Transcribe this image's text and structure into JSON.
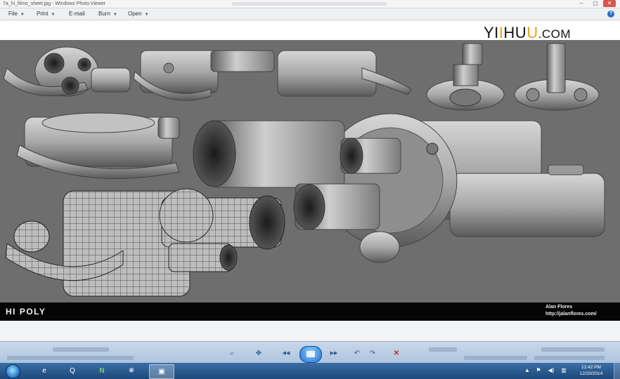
{
  "window": {
    "title": "7a_hi_filmo_sheet.jpg - Windows Photo Viewer",
    "minimize_glyph": "–",
    "maximize_glyph": "▢",
    "close_glyph": "✕"
  },
  "menu": {
    "items": [
      {
        "label": "File",
        "has_arrow": true
      },
      {
        "label": "Print",
        "has_arrow": true
      },
      {
        "label": "E-mail",
        "has_arrow": false
      },
      {
        "label": "Burn",
        "has_arrow": true
      },
      {
        "label": "Open",
        "has_arrow": true
      }
    ],
    "arrow_glyph": "▼",
    "help_glyph": "?"
  },
  "watermark": {
    "part1": "YI",
    "part2": "I",
    "part3": "HU",
    "part4": "U",
    "part5": ".COM"
  },
  "image": {
    "caption_left": "HI POLY",
    "author": "Alan Flores",
    "author_url": "http://jalanflores.com/"
  },
  "viewer_toolbar": {
    "zoom_glyph": "⌕",
    "actual_size_glyph": "✥",
    "previous_glyph": "◀◀",
    "next_glyph": "▶▶",
    "rotate_ccw_glyph": "↶",
    "rotate_cw_glyph": "↷",
    "delete_glyph": "✕"
  },
  "taskbar": {
    "apps": [
      {
        "name": "ie-app",
        "glyph": "e"
      },
      {
        "name": "quicktime-app",
        "glyph": "Q"
      },
      {
        "name": "n-app",
        "glyph": "N"
      },
      {
        "name": "network-app",
        "glyph": "❄"
      },
      {
        "name": "photo-viewer-app",
        "glyph": "▣"
      }
    ],
    "tray_expand_glyph": "▲",
    "flag_glyph": "⚑",
    "volume_glyph": "◀)",
    "network_glyph": "▥",
    "time": "12:42 PM",
    "date": "12/20/2014"
  },
  "colors": {
    "accent_logo": "#e8a317",
    "viewport_bg": "#6e6e6e",
    "taskbar_top": "#3b6fa6",
    "taskbar_bottom": "#1c477b"
  }
}
